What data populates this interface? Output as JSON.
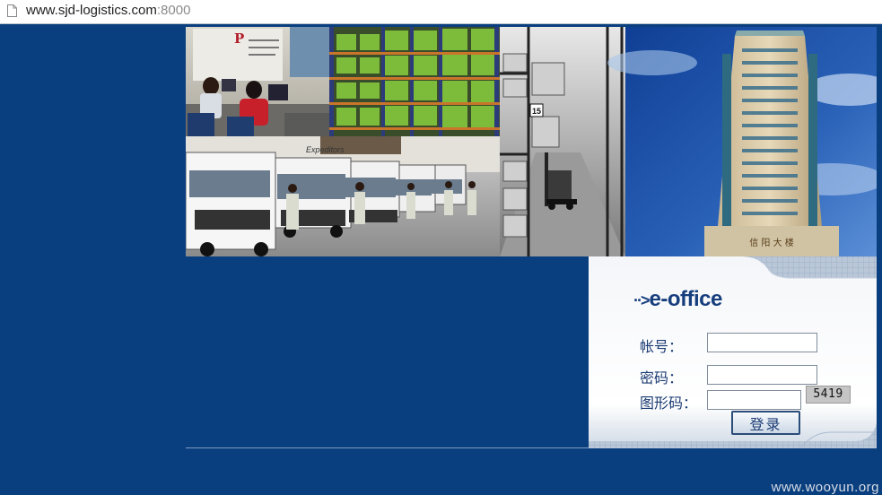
{
  "browser": {
    "url_host": "www.sjd-logistics.com",
    "url_port": ":8000",
    "page_icon": "page-icon"
  },
  "banner": {
    "truck_label": "Expeditors",
    "rack_number": "15",
    "building_sign": "信 阳 大 楼"
  },
  "login": {
    "brand_arrow": "··>",
    "brand": "e-office",
    "account_label": "帐号：",
    "password_label": "密码：",
    "captcha_label": "图形码：",
    "account_value": "",
    "password_value": "",
    "captcha_value": "",
    "captcha_code": "5419",
    "submit_label": "登录"
  },
  "watermark": "www.wooyun.org",
  "colors": {
    "page_background": "#0a3f7f",
    "brand_text": "#173e7d",
    "label_text": "#1c3c74"
  }
}
